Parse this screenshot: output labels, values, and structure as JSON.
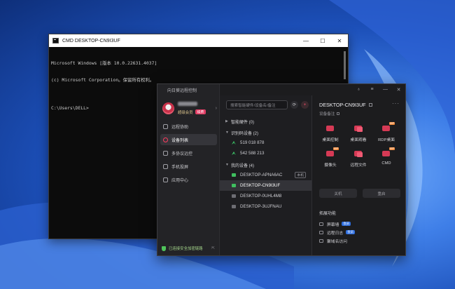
{
  "cmd": {
    "title": "CMD DESKTOP-CN9I3UF",
    "controls": {
      "minimize": "—",
      "maximize": "☐",
      "close": "✕"
    },
    "lines": [
      "Microsoft Windows [版本 10.0.22631.4037]",
      "(c) Microsoft Corporation。保留所有权利。",
      "",
      "C:\\Users\\DELL>"
    ]
  },
  "app": {
    "title": "向日葵远程控制",
    "controls": {
      "pin": "♁",
      "menu": "≡",
      "minimize": "—",
      "close": "✕"
    },
    "user": {
      "membership": "超级会员",
      "badge": "续费"
    },
    "nav": [
      {
        "label": "远程协助",
        "active": false
      },
      {
        "label": "设备列表",
        "active": true
      },
      {
        "label": "多协议远控",
        "active": false
      },
      {
        "label": "手机投屏",
        "active": false
      },
      {
        "label": "应用中心",
        "active": false
      }
    ],
    "footer": "已连接安全加密链路",
    "search": {
      "placeholder": "搜索智能硬件/设备名/备注"
    },
    "groups": [
      {
        "label": "智能硬件 (0)",
        "devices": []
      },
      {
        "label": "识别码设备 (2)",
        "devices": [
          {
            "name": "519 018 878",
            "status": "link"
          },
          {
            "name": "542 588 213",
            "status": "link"
          }
        ]
      },
      {
        "label": "我的设备 (4)",
        "devices": [
          {
            "name": "DESKTOP-APNA6AC",
            "status": "green",
            "tag": "本机"
          },
          {
            "name": "DESKTOP-CN9I3UF",
            "status": "green",
            "selected": true
          },
          {
            "name": "DESKTOP-0UHL4M8",
            "status": "grey"
          },
          {
            "name": "DESKTOP-3UJFNAU",
            "status": "grey"
          }
        ]
      }
    ],
    "detail": {
      "name": "DESKTOP-CN9I3UF",
      "more": "···",
      "note": "设备备注",
      "actions": [
        {
          "label": "桌面控制",
          "vip": ""
        },
        {
          "label": "桌面观看",
          "vip": ""
        },
        {
          "label": "RDP桌面",
          "vip": "VIP"
        },
        {
          "label": "摄像头",
          "vip": "VIP"
        },
        {
          "label": "远程文件",
          "vip": ""
        },
        {
          "label": "CMD",
          "vip": "VIP"
        }
      ],
      "shutdown": "关机",
      "restart": "重启",
      "ext_title": "拓展功能",
      "ext": [
        {
          "label": "屏幕墙",
          "badge": "会员"
        },
        {
          "label": "远程日志",
          "badge": "会员"
        },
        {
          "label": "聚域名访问",
          "badge": ""
        }
      ]
    }
  }
}
